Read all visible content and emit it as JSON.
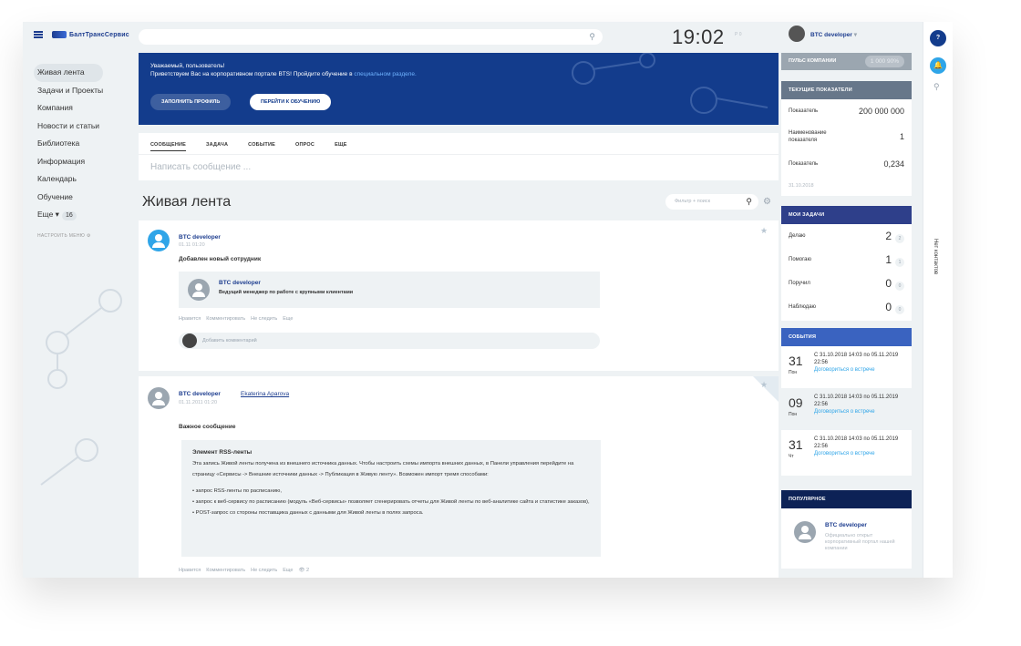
{
  "topbar": {
    "logo_text": "БалтТрансСервис",
    "clock": "19:02",
    "clock_sub": "Р 0"
  },
  "sidebar": {
    "items": [
      {
        "label": "Живая лента",
        "active": true
      },
      {
        "label": "Задачи и Проекты"
      },
      {
        "label": "Компания"
      },
      {
        "label": "Новости и статьи"
      },
      {
        "label": "Библиотека"
      },
      {
        "label": "Информация"
      },
      {
        "label": "Календарь"
      },
      {
        "label": "Обучение"
      }
    ],
    "more_label": "Еще",
    "more_count": "16",
    "setup_menu": "НАСТРОИТЬ МЕНЮ"
  },
  "banner": {
    "line1": "Уважаемый, пользователь!",
    "line2": "Приветствуем Вас на корпоративном портале BTS! Пройдите обучение в",
    "line2_link": "специальном разделе.",
    "btn_profile": "ЗАПОЛНИТЬ ПРОФИЛЬ",
    "btn_training": "ПЕРЕЙТИ К ОБУЧЕНИЮ"
  },
  "composer": {
    "tabs": [
      "СООБЩЕНИЕ",
      "ЗАДАЧА",
      "СОБЫТИЕ",
      "ОПРОС",
      "ЕЩЕ"
    ],
    "placeholder": "Написать сообщение ..."
  },
  "feed": {
    "title": "Живая лента",
    "filter_placeholder": "Фильтр + поиск"
  },
  "post1": {
    "author": "BTC developer",
    "date": "01.11 01:20",
    "title": "Добавлен новый сотрудник",
    "card_name": "BTC developer",
    "card_role": "Ведущий менеджер по работе с крупными клиентами",
    "actions": [
      "Нравится",
      "Комментировать",
      "Не следить",
      "Еще"
    ],
    "comment_placeholder": "Добавить комментарий"
  },
  "post2": {
    "author": "BTC developer",
    "recipient": "Ekaterina Aparova",
    "date": "01.11.2011 01:20",
    "title": "Важное сообщение",
    "rss_title": "Элемент RSS-ленты",
    "rss_text": "Эта запись Живой ленты получена из внешнего источника данных. Чтобы настроить схемы импорта внешних данных, в Панели управления перейдите на страницу «Сервисы -> Внешние источники данных -> Публикация в Живую ленту». Возможен импорт тремя способами:",
    "li1": "• запрос RSS-ленты по расписанию,",
    "li2": "• запрос к веб-сервису по расписанию (модуль «Веб-сервисы» позволяет сгенерировать отчеты для Живой ленты по веб-аналитике сайта и статистике заказов),",
    "li3": "• POST-запрос со стороны поставщика данных с данными для Живой ленты в полях запроса.",
    "actions": [
      "Нравится",
      "Комментировать",
      "Не следить",
      "Еще",
      "👁 2"
    ]
  },
  "right": {
    "user": "BTC developer",
    "pulse_label": "ПУЛЬС КОМПАНИИ",
    "pulse_value": "1 000  90%",
    "indicators_title": "ТЕКУЩИЕ ПОКАЗАТЕЛИ",
    "indicators": [
      {
        "k": "Показатель",
        "v": "200 000 000"
      },
      {
        "k": "Наименование показателя",
        "v": "1"
      },
      {
        "k": "Показатель",
        "v": "0,234"
      }
    ],
    "indicators_date": "31.10.2018",
    "tasks_title": "МОИ ЗАДАЧИ",
    "tasks": [
      {
        "k": "Делаю",
        "n": "2",
        "b": "2"
      },
      {
        "k": "Помогаю",
        "n": "1",
        "b": "1"
      },
      {
        "k": "Поручил",
        "n": "0",
        "b": "0"
      },
      {
        "k": "Наблюдаю",
        "n": "0",
        "b": "0"
      }
    ],
    "events_title": "СОБЫТИЯ",
    "events": [
      {
        "day": "31",
        "wd": "Пон",
        "t": "С 31.10.2018 14:03 по 05.11.2019 22:56",
        "l": "Договориться о встрече"
      },
      {
        "day": "09",
        "wd": "Пон",
        "t": "С 31.10.2018 14:03 по 05.11.2019 22:56",
        "l": "Договориться о встрече"
      },
      {
        "day": "31",
        "wd": "Чт",
        "t": "С 31.10.2018 14:03 по 05.11.2019 22:56",
        "l": "Договориться о встрече"
      }
    ],
    "popular_title": "ПОПУЛЯРНОЕ",
    "popular_name": "BTC developer",
    "popular_desc": "Официально открыт корпоративный портал нашей компании"
  },
  "strip": {
    "help": "?",
    "no_contacts": "Нет контактов"
  }
}
